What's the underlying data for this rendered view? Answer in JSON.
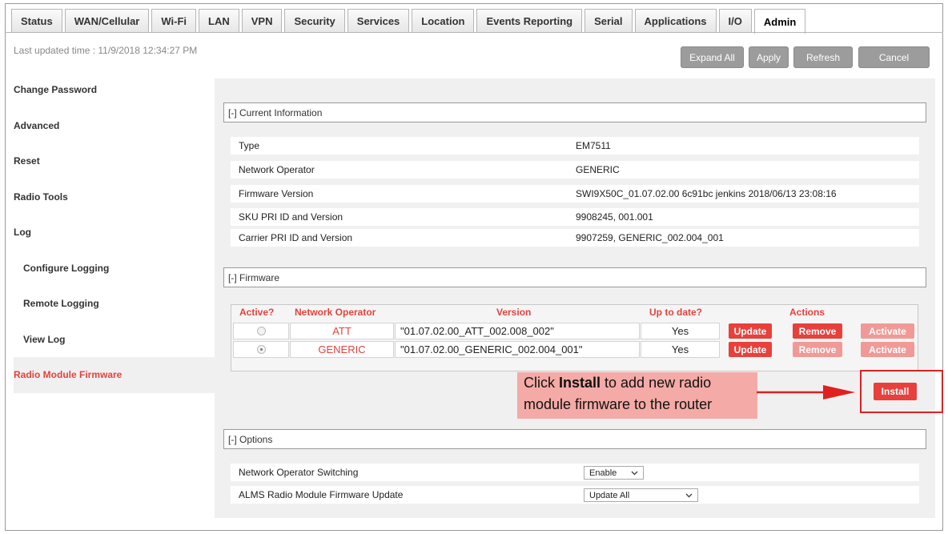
{
  "tabs": [
    {
      "label": "Status"
    },
    {
      "label": "WAN/Cellular"
    },
    {
      "label": "Wi-Fi"
    },
    {
      "label": "LAN"
    },
    {
      "label": "VPN"
    },
    {
      "label": "Security"
    },
    {
      "label": "Services"
    },
    {
      "label": "Location"
    },
    {
      "label": "Events Reporting"
    },
    {
      "label": "Serial"
    },
    {
      "label": "Applications"
    },
    {
      "label": "I/O"
    },
    {
      "label": "Admin"
    }
  ],
  "last_updated": "Last updated time : 11/9/2018 12:34:27 PM",
  "toolbar": {
    "expand_all": "Expand All",
    "apply": "Apply",
    "refresh": "Refresh",
    "cancel": "Cancel"
  },
  "sidebar": {
    "items": [
      {
        "label": "Change Password"
      },
      {
        "label": "Advanced"
      },
      {
        "label": "Reset"
      },
      {
        "label": "Radio Tools"
      },
      {
        "label": "Log"
      },
      {
        "label": "Configure Logging"
      },
      {
        "label": "Remote Logging"
      },
      {
        "label": "View Log"
      },
      {
        "label": "Radio Module Firmware"
      }
    ]
  },
  "sections": {
    "current_info": "[-] Current Information",
    "firmware": "[-] Firmware",
    "options": "[-] Options"
  },
  "current_info": [
    {
      "label": "Type",
      "value": "EM7511"
    },
    {
      "label": "Network Operator",
      "value": "GENERIC"
    },
    {
      "label": "Firmware Version",
      "value": "SWI9X50C_01.07.02.00 6c91bc jenkins 2018/06/13 23:08:16"
    },
    {
      "label": "SKU PRI ID and Version",
      "value": "9908245, 001.001"
    },
    {
      "label": "Carrier PRI ID and Version",
      "value": "9907259, GENERIC_002.004_001"
    }
  ],
  "firmware_table": {
    "headers": {
      "active": "Active?",
      "operator": "Network Operator",
      "version": "Version",
      "uptodate": "Up to date?",
      "actions": "Actions"
    },
    "rows": [
      {
        "operator": "ATT",
        "version": "\"01.07.02.00_ATT_002.008_002\"",
        "uptodate": "Yes",
        "active": false
      },
      {
        "operator": "GENERIC",
        "version": "\"01.07.02.00_GENERIC_002.004_001\"",
        "uptodate": "Yes",
        "active": true
      }
    ],
    "update_label": "Update",
    "remove_label": "Remove",
    "activate_label": "Activate"
  },
  "callout": {
    "line1_pre": "Click ",
    "line1_bold": "Install",
    "line1_post": " to add new radio",
    "line2": "module firmware to the router"
  },
  "install_label": "Install",
  "options": [
    {
      "label": "Network Operator Switching",
      "value": "Enable"
    },
    {
      "label": "ALMS Radio Module Firmware Update",
      "value": "Update All"
    }
  ],
  "colors": {
    "accent": "#e8403b",
    "button_gray": "#9c9c9c",
    "content_bg": "#f0f0f0"
  }
}
